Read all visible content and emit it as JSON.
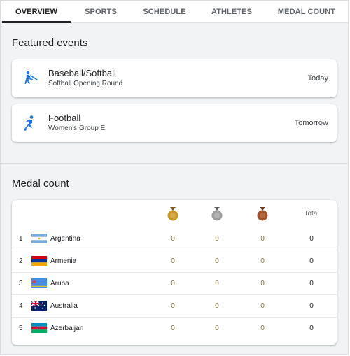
{
  "tabs": [
    {
      "label": "OVERVIEW",
      "active": true
    },
    {
      "label": "SPORTS",
      "active": false
    },
    {
      "label": "SCHEDULE",
      "active": false
    },
    {
      "label": "ATHLETES",
      "active": false
    },
    {
      "label": "MEDAL COUNT",
      "active": false
    }
  ],
  "featured": {
    "title": "Featured events",
    "events": [
      {
        "sport": "Baseball/Softball",
        "detail": "Softball Opening Round",
        "when": "Today",
        "icon": "baseball-icon"
      },
      {
        "sport": "Football",
        "detail": "Women's Group E",
        "when": "Tomorrow",
        "icon": "football-icon"
      }
    ]
  },
  "medals": {
    "title": "Medal count",
    "total_label": "Total",
    "gold_color": "#c9962b",
    "silver_color": "#9e9e9e",
    "bronze_color": "#a0522d",
    "rows": [
      {
        "rank": "1",
        "country": "Argentina",
        "flag": "argentina-flag",
        "gold": "0",
        "silver": "0",
        "bronze": "0",
        "total": "0"
      },
      {
        "rank": "2",
        "country": "Armenia",
        "flag": "armenia-flag",
        "gold": "0",
        "silver": "0",
        "bronze": "0",
        "total": "0"
      },
      {
        "rank": "3",
        "country": "Aruba",
        "flag": "aruba-flag",
        "gold": "0",
        "silver": "0",
        "bronze": "0",
        "total": "0"
      },
      {
        "rank": "4",
        "country": "Australia",
        "flag": "australia-flag",
        "gold": "0",
        "silver": "0",
        "bronze": "0",
        "total": "0"
      },
      {
        "rank": "5",
        "country": "Azerbaijan",
        "flag": "azerbaijan-flag",
        "gold": "0",
        "silver": "0",
        "bronze": "0",
        "total": "0"
      }
    ]
  }
}
